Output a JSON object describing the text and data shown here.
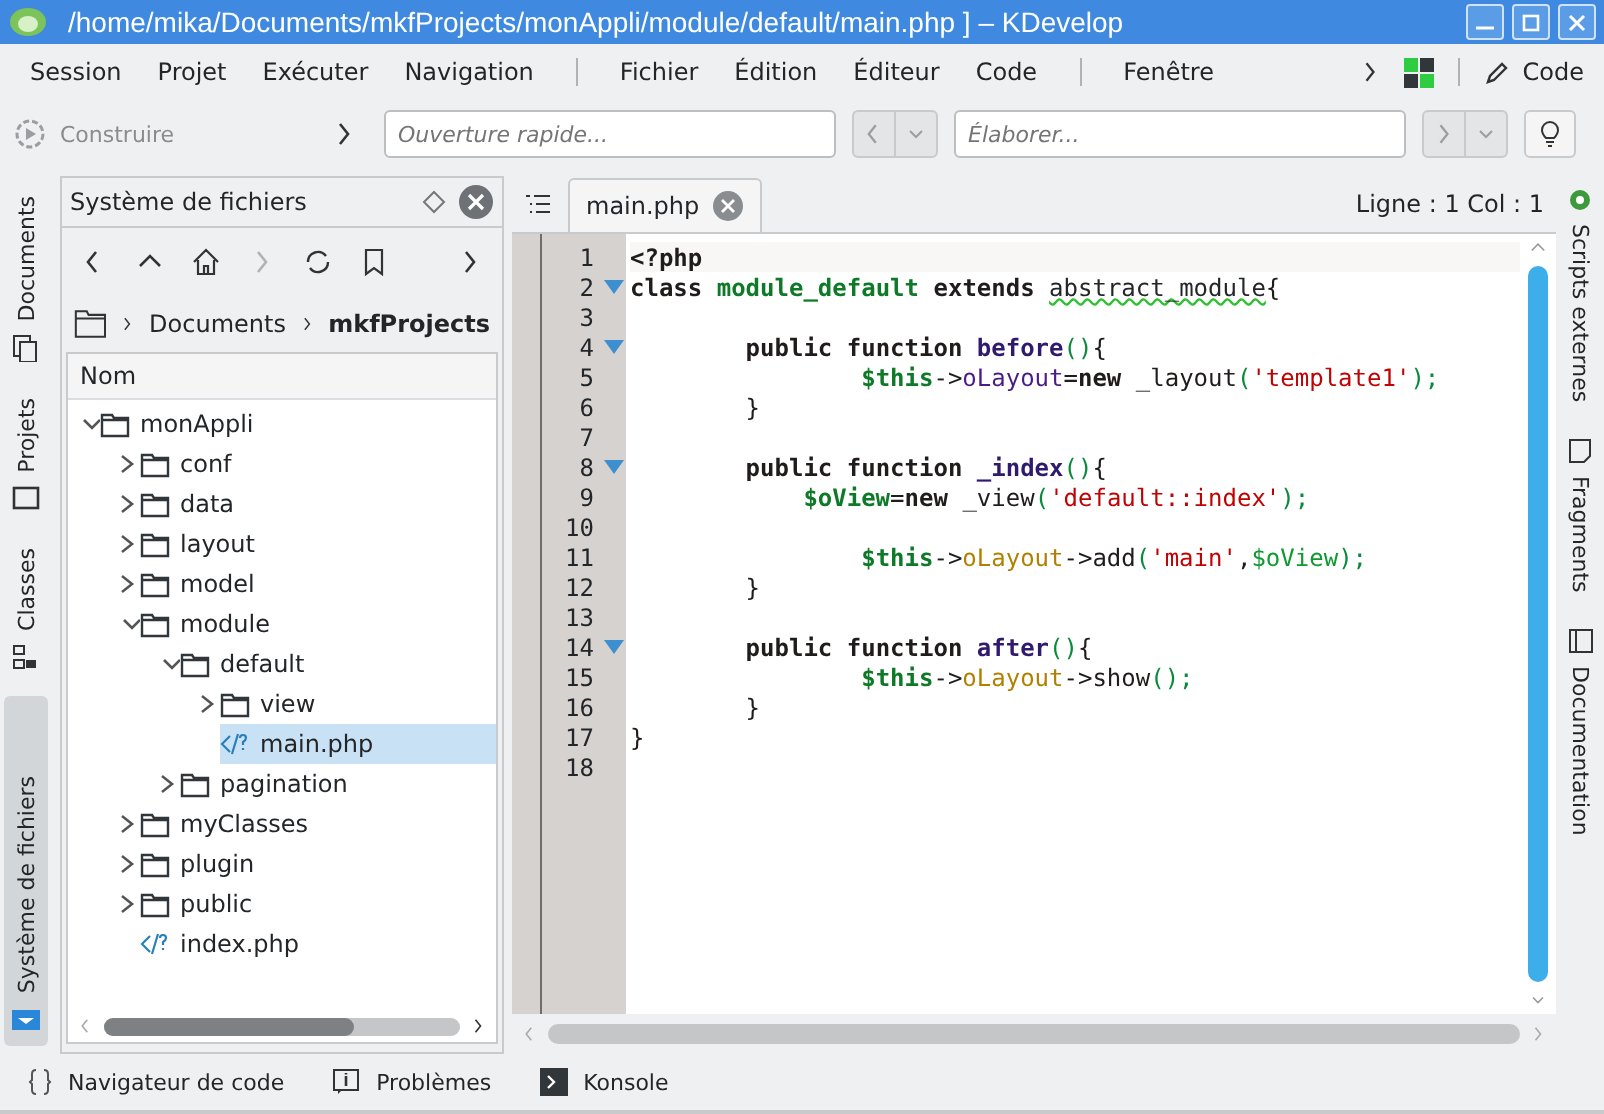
{
  "window": {
    "title": "/home/mika/Documents/mkfProjects/monAppli/module/default/main.php ] – KDevelop"
  },
  "menu": {
    "groups": [
      [
        "Session",
        "Projet",
        "Exécuter",
        "Navigation"
      ],
      [
        "Fichier",
        "Édition",
        "Éditeur",
        "Code"
      ],
      [
        "Fenêtre"
      ]
    ],
    "area_button": "Code"
  },
  "toolbar": {
    "build": "Construire",
    "quick_open": {
      "placeholder": "Ouverture rapide..."
    },
    "outline": {
      "placeholder": "Élaborer..."
    }
  },
  "left_tabs": [
    {
      "label": "Documents",
      "selected": false
    },
    {
      "label": "Projets",
      "selected": false
    },
    {
      "label": "Classes",
      "selected": false
    },
    {
      "label": "Système de fichiers",
      "selected": true
    }
  ],
  "filesystem": {
    "title": "Système de fichiers",
    "breadcrumb": [
      "Documents",
      "mkfProjects"
    ],
    "column": "Nom",
    "tree": [
      {
        "name": "monAppli",
        "kind": "folder",
        "expanded": true,
        "selected": false,
        "children": [
          {
            "name": "conf",
            "kind": "folder",
            "expanded": false,
            "selected": false
          },
          {
            "name": "data",
            "kind": "folder",
            "expanded": false,
            "selected": false
          },
          {
            "name": "layout",
            "kind": "folder",
            "expanded": false,
            "selected": false
          },
          {
            "name": "model",
            "kind": "folder",
            "expanded": false,
            "selected": false
          },
          {
            "name": "module",
            "kind": "folder",
            "expanded": true,
            "selected": false,
            "children": [
              {
                "name": "default",
                "kind": "folder",
                "expanded": true,
                "selected": false,
                "children": [
                  {
                    "name": "view",
                    "kind": "folder",
                    "expanded": false,
                    "selected": false
                  },
                  {
                    "name": "main.php",
                    "kind": "file",
                    "selected": true
                  }
                ]
              },
              {
                "name": "pagination",
                "kind": "folder",
                "expanded": false,
                "selected": false
              }
            ]
          },
          {
            "name": "myClasses",
            "kind": "folder",
            "expanded": false,
            "selected": false
          },
          {
            "name": "plugin",
            "kind": "folder",
            "expanded": false,
            "selected": false
          },
          {
            "name": "public",
            "kind": "folder",
            "expanded": false,
            "selected": false
          },
          {
            "name": "index.php",
            "kind": "file",
            "selected": false
          }
        ]
      }
    ]
  },
  "editor": {
    "tab": "main.php",
    "position": "Ligne : 1 Col : 1",
    "lines": [
      {
        "number": "1",
        "fold": false,
        "tokens": [
          {
            "kind": "kw",
            "text": "<?php"
          }
        ]
      },
      {
        "number": "2",
        "fold": true,
        "tokens": [
          {
            "kind": "kw",
            "text": "class "
          },
          {
            "kind": "cls",
            "text": "module_default"
          },
          {
            "kind": "kw",
            "text": " extends "
          },
          {
            "kind": "type",
            "text": "abstract_module"
          },
          {
            "kind": "plain",
            "text": "{"
          }
        ]
      },
      {
        "number": "3",
        "fold": false
      },
      {
        "number": "4",
        "fold": true,
        "kind": "method",
        "tokens": [
          {
            "kind": "kw",
            "text": "public function "
          },
          {
            "kind": "fn",
            "text": "before"
          },
          {
            "kind": "paren",
            "text": "()"
          },
          {
            "kind": "plain",
            "text": "{"
          }
        ]
      },
      {
        "number": "5",
        "fold": false,
        "kind": "body",
        "tokens": [
          {
            "kind": "var",
            "text": "$this"
          },
          {
            "kind": "plain",
            "text": "->"
          },
          {
            "kind": "mem",
            "text": "oLayout"
          },
          {
            "kind": "plain",
            "text": "="
          },
          {
            "kind": "kw",
            "text": "new"
          },
          {
            "kind": "plain",
            "text": " _layout"
          },
          {
            "kind": "paren",
            "text": "("
          },
          {
            "kind": "str",
            "text": "'template1'"
          },
          {
            "kind": "paren",
            "text": ");"
          }
        ]
      },
      {
        "number": "6",
        "fold": false,
        "kind": "method",
        "tokens": [
          {
            "kind": "plain",
            "text": "}"
          }
        ]
      },
      {
        "number": "7",
        "fold": false
      },
      {
        "number": "8",
        "fold": true,
        "kind": "method",
        "tokens": [
          {
            "kind": "kw",
            "text": "public function "
          },
          {
            "kind": "fn",
            "text": "_index"
          },
          {
            "kind": "paren",
            "text": "()"
          },
          {
            "kind": "plain",
            "text": "{"
          }
        ]
      },
      {
        "number": "9",
        "fold": false,
        "kind": "local",
        "tokens": [
          {
            "kind": "var",
            "text": "$oView"
          },
          {
            "kind": "plain",
            "text": "="
          },
          {
            "kind": "kw",
            "text": "new"
          },
          {
            "kind": "plain",
            "text": " _view"
          },
          {
            "kind": "paren",
            "text": "("
          },
          {
            "kind": "str",
            "text": "'default::index'"
          },
          {
            "kind": "paren",
            "text": ");"
          }
        ]
      },
      {
        "number": "10",
        "fold": false
      },
      {
        "number": "11",
        "fold": false,
        "kind": "body",
        "tokens": [
          {
            "kind": "var",
            "text": "$this"
          },
          {
            "kind": "plain",
            "text": "->"
          },
          {
            "kind": "prop",
            "text": "oLayout"
          },
          {
            "kind": "plain",
            "text": "->add"
          },
          {
            "kind": "paren",
            "text": "("
          },
          {
            "kind": "str",
            "text": "'main'"
          },
          {
            "kind": "plain",
            "text": ","
          },
          {
            "kind": "localvar",
            "text": "$oView"
          },
          {
            "kind": "paren",
            "text": ");"
          }
        ]
      },
      {
        "number": "12",
        "fold": false,
        "kind": "method",
        "tokens": [
          {
            "kind": "plain",
            "text": "}"
          }
        ]
      },
      {
        "number": "13",
        "fold": false
      },
      {
        "number": "14",
        "fold": true,
        "kind": "method",
        "tokens": [
          {
            "kind": "kw",
            "text": "public function "
          },
          {
            "kind": "fn",
            "text": "after"
          },
          {
            "kind": "paren",
            "text": "()"
          },
          {
            "kind": "plain",
            "text": "{"
          }
        ]
      },
      {
        "number": "15",
        "fold": false,
        "kind": "body",
        "tokens": [
          {
            "kind": "var",
            "text": "$this"
          },
          {
            "kind": "plain",
            "text": "->"
          },
          {
            "kind": "prop",
            "text": "oLayout"
          },
          {
            "kind": "plain",
            "text": "->show"
          },
          {
            "kind": "paren",
            "text": "();"
          }
        ]
      },
      {
        "number": "16",
        "fold": false,
        "kind": "method",
        "tokens": [
          {
            "kind": "plain",
            "text": "}"
          }
        ]
      },
      {
        "number": "17",
        "fold": false,
        "tokens": [
          {
            "kind": "plain",
            "text": "}"
          }
        ]
      },
      {
        "number": "18",
        "fold": false
      }
    ]
  },
  "right_tabs": [
    {
      "label": "Scripts externes",
      "selected": false
    },
    {
      "label": "Fragments",
      "selected": false
    },
    {
      "label": "Documentation",
      "selected": false
    }
  ],
  "bottom_tabs": [
    {
      "label": "Navigateur de code",
      "kind": "braces"
    },
    {
      "label": "Problèmes",
      "kind": "info"
    },
    {
      "label": "Konsole",
      "kind": "terminal"
    }
  ]
}
